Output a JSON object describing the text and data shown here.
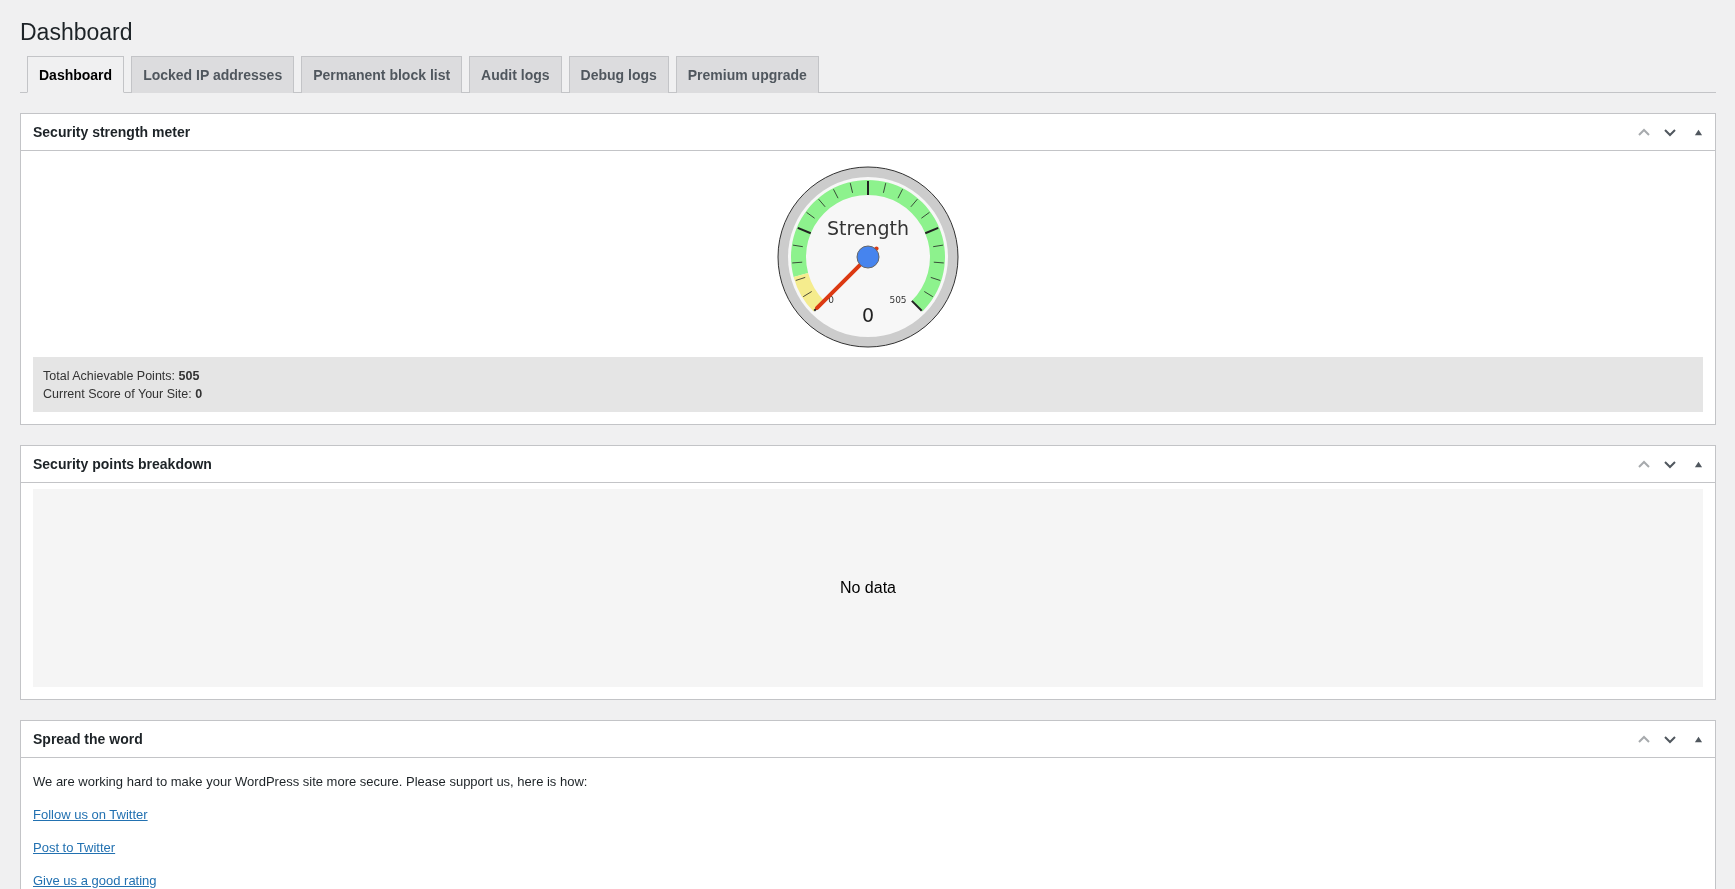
{
  "page_title": "Dashboard",
  "tabs": [
    {
      "label": "Dashboard",
      "selected": true
    },
    {
      "label": "Locked IP addresses",
      "selected": false
    },
    {
      "label": "Permanent block list",
      "selected": false
    },
    {
      "label": "Audit logs",
      "selected": false
    },
    {
      "label": "Debug logs",
      "selected": false
    },
    {
      "label": "Premium upgrade",
      "selected": false
    }
  ],
  "panels": [
    {
      "kind": "meter",
      "title": "Security strength meter",
      "move_up_disabled": true,
      "gauge": {
        "label": "Strength",
        "min_label": "0",
        "max_label": "505",
        "value": "0"
      },
      "summary": [
        "Total Achievable Points: **505**",
        "Current Score of Your Site: **0**"
      ]
    },
    {
      "kind": "empty",
      "title": "Security points breakdown",
      "move_up_disabled": true,
      "message": "No data"
    },
    {
      "kind": "links",
      "title": "Spread the word",
      "move_up_disabled": true,
      "intro": "We are working hard to make your WordPress site more secure. Please support us, here is how:",
      "links": [
        "Follow us on Twitter",
        "Post to Twitter",
        "Give us a good rating"
      ]
    }
  ]
}
